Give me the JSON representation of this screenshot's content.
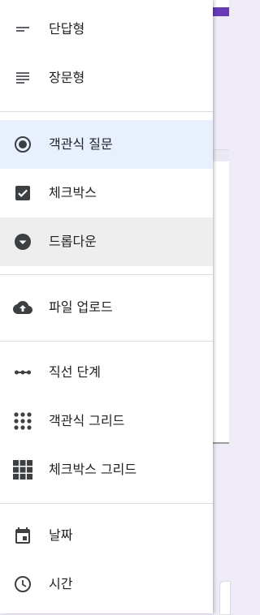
{
  "menu": {
    "items": [
      {
        "label": "단답형",
        "icon": "short-answer-icon"
      },
      {
        "label": "장문형",
        "icon": "paragraph-icon"
      },
      {
        "label": "객관식 질문",
        "icon": "radio-button-icon"
      },
      {
        "label": "체크박스",
        "icon": "checkbox-icon"
      },
      {
        "label": "드롭다운",
        "icon": "dropdown-icon"
      },
      {
        "label": "파일 업로드",
        "icon": "cloud-upload-icon"
      },
      {
        "label": "직선 단계",
        "icon": "linear-scale-icon"
      },
      {
        "label": "객관식 그리드",
        "icon": "radio-grid-icon"
      },
      {
        "label": "체크박스 그리드",
        "icon": "checkbox-grid-icon"
      },
      {
        "label": "날짜",
        "icon": "calendar-icon"
      },
      {
        "label": "시간",
        "icon": "clock-icon"
      }
    ],
    "selected_index": 2,
    "hovered_index": 4
  },
  "colors": {
    "selected_bg": "#e8f0fe",
    "hover_bg": "#eeeeee",
    "icon": "#5f6368",
    "icon_dark": "#3c4043",
    "text": "#202124",
    "brand_purple": "#673ab7",
    "background": "#f0ebf8"
  }
}
